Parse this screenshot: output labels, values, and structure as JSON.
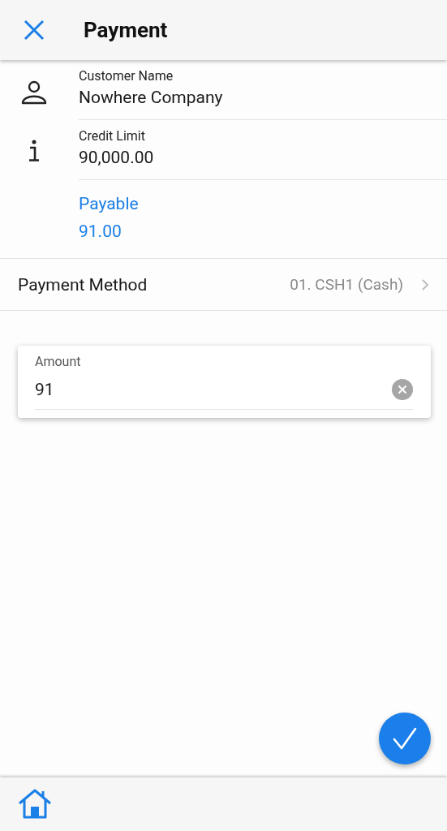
{
  "header": {
    "title": "Payment"
  },
  "details": [
    {
      "kind": "person",
      "label": "Customer Name",
      "value": "Nowhere Company"
    },
    {
      "kind": "info",
      "label": "Credit Limit",
      "value": "90,000.00"
    },
    {
      "kind": "highlight",
      "label": "Payable",
      "value": "91.00"
    }
  ],
  "payment_method": {
    "label": "Payment Method",
    "value": "01. CSH1 (Cash)"
  },
  "amount_field": {
    "label": "Amount",
    "value": "91"
  }
}
